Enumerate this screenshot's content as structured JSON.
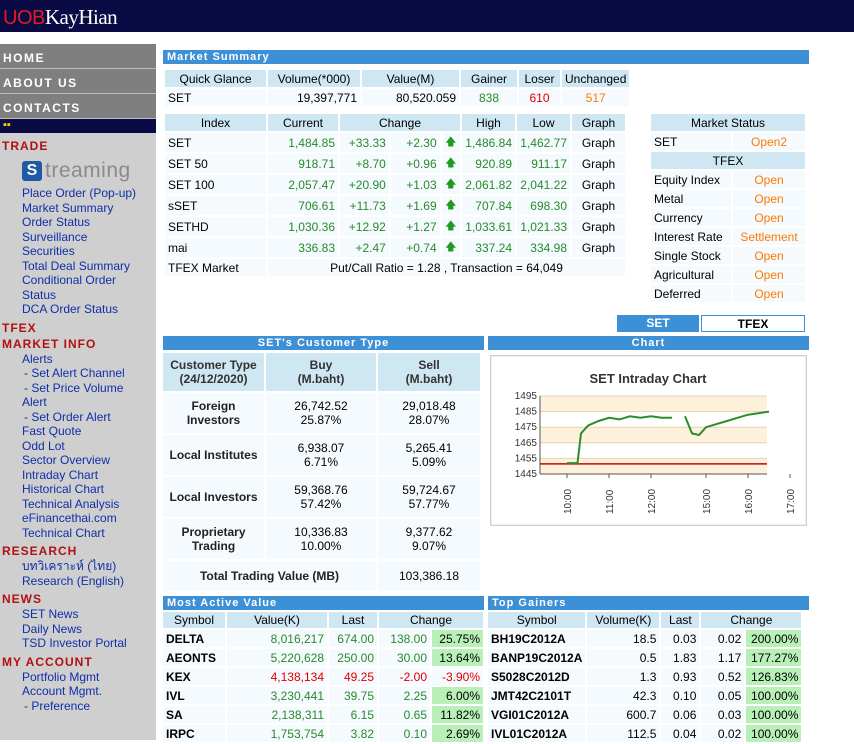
{
  "brand": {
    "part1": "UOB",
    "part2": "KayHian"
  },
  "nav": {
    "home": "HOME",
    "about": "ABOUT US",
    "contacts": "CONTACTS",
    "dots": "▪▪"
  },
  "side": {
    "trade": "TRADE",
    "streaming": "treaming",
    "streaming_s": "S",
    "trade_links": [
      "Place Order (Pop-up)",
      "Market Summary",
      "Order Status",
      "Surveillance",
      "Securities",
      "Total Deal Summary",
      "Conditional Order",
      "Status",
      "DCA Order Status"
    ],
    "tfex": "TFEX",
    "market_info": "MARKET INFO",
    "mi_links": [
      "Alerts",
      "- Set Alert Channel",
      "- Set Price Volume",
      "Alert",
      "- Set Order Alert",
      "Fast Quote",
      "Odd Lot",
      "Sector Overview",
      "Intraday Chart",
      "Historical Chart",
      "Technical Analysis",
      "eFinancethai.com",
      "Technical Chart"
    ],
    "research": "RESEARCH",
    "research_links": [
      "บทวิเคราะห์ (ไทย)",
      "Research (English)"
    ],
    "news": "NEWS",
    "news_links": [
      "SET News",
      "Daily News",
      "TSD Investor Portal"
    ],
    "myacc": "MY ACCOUNT",
    "acc_links": [
      "Portfolio Mgmt",
      "Account Mgmt.",
      "- Preference"
    ]
  },
  "summary": {
    "title": "Market Summary",
    "quick": {
      "headers": [
        "Quick Glance",
        "Volume(*000)",
        "Value(M)",
        "Gainer",
        "Loser",
        "Unchanged"
      ],
      "row": [
        "SET",
        "19,397,771",
        "80,520.059",
        "838",
        "610",
        "517"
      ]
    },
    "index": {
      "headers": [
        "Index",
        "Current",
        "Change",
        "High",
        "Low",
        "Graph"
      ],
      "rows": [
        [
          "SET",
          "1,484.85",
          "+33.33",
          "+2.30",
          "1,486.84",
          "1,462.77",
          "Graph"
        ],
        [
          "SET 50",
          "918.71",
          "+8.70",
          "+0.96",
          "920.89",
          "911.17",
          "Graph"
        ],
        [
          "SET 100",
          "2,057.47",
          "+20.90",
          "+1.03",
          "2,061.82",
          "2,041.22",
          "Graph"
        ],
        [
          "sSET",
          "706.61",
          "+11.73",
          "+1.69",
          "707.84",
          "698.30",
          "Graph"
        ],
        [
          "SETHD",
          "1,030.36",
          "+12.92",
          "+1.27",
          "1,033.61",
          "1,021.33",
          "Graph"
        ],
        [
          "mai",
          "336.83",
          "+2.47",
          "+0.74",
          "337.24",
          "334.98",
          "Graph"
        ]
      ],
      "tfex_label": "TFEX Market",
      "tfex_info": "Put/Call Ratio = 1.28 , Transaction = 64,049"
    },
    "status": {
      "header": "Market Status",
      "set_label": "SET",
      "set_val": "Open2",
      "tfex": "TFEX",
      "rows": [
        [
          "Equity Index",
          "Open"
        ],
        [
          "Metal",
          "Open"
        ],
        [
          "Currency",
          "Open"
        ],
        [
          "Interest Rate",
          "Settlement"
        ],
        [
          "Single Stock",
          "Open"
        ],
        [
          "Agricultural",
          "Open"
        ],
        [
          "Deferred",
          "Open"
        ]
      ]
    }
  },
  "tabs": {
    "set": "SET",
    "tfex": "TFEX"
  },
  "cust": {
    "title": "SET's Customer Type",
    "headers": [
      "Customer Type\n(24/12/2020)",
      "Buy\n(M.baht)",
      "Sell\n(M.baht)"
    ],
    "rows": [
      [
        "Foreign Investors",
        "26,742.52",
        "25.87%",
        "29,018.48",
        "28.07%"
      ],
      [
        "Local Institutes",
        "6,938.07",
        "6.71%",
        "5,265.41",
        "5.09%"
      ],
      [
        "Local Investors",
        "59,368.76",
        "57.42%",
        "59,724.67",
        "57.77%"
      ],
      [
        "Proprietary\nTrading",
        "10,336.83",
        "10.00%",
        "9,377.62",
        "9.07%"
      ]
    ],
    "total_label": "Total Trading Value (MB)",
    "total": "103,386.18"
  },
  "chart": {
    "bar": "Chart"
  },
  "chart_data": {
    "type": "line",
    "title": "SET Intraday Chart",
    "ylim": [
      1445,
      1495
    ],
    "yticks": [
      1495,
      1485,
      1475,
      1465,
      1455,
      1445
    ],
    "xticks": [
      "10:00",
      "11:00",
      "12:00",
      "15:00",
      "16:00",
      "17:00"
    ],
    "reference": 1451.52,
    "series": [
      {
        "x": [
          "10:00",
          "10:15",
          "10:20",
          "10:30",
          "10:45",
          "11:00",
          "11:15",
          "11:30",
          "11:45",
          "12:00",
          "12:15",
          "12:30",
          "14:30",
          "14:40",
          "14:50",
          "15:00",
          "15:15",
          "15:30",
          "15:45",
          "16:00",
          "16:15",
          "16:30"
        ],
        "y": [
          1452,
          1452,
          1471,
          1476,
          1479,
          1481,
          1480,
          1482,
          1481,
          1482,
          1481,
          1481,
          1482,
          1471,
          1470,
          1475,
          1477,
          1479,
          1481,
          1483,
          1484,
          1485
        ]
      }
    ]
  },
  "active": {
    "title": "Most Active Value",
    "headers": [
      "Symbol",
      "Value(K)",
      "Last",
      "Change"
    ],
    "rows": [
      [
        "DELTA",
        "8,016,217",
        "674.00",
        "138.00",
        "25.75%",
        "g"
      ],
      [
        "AEONTS",
        "5,220,628",
        "250.00",
        "30.00",
        "13.64%",
        "g"
      ],
      [
        "KEX",
        "4,138,134",
        "49.25",
        "-2.00",
        "-3.90%",
        "r"
      ],
      [
        "IVL",
        "3,230,441",
        "39.75",
        "2.25",
        "6.00%",
        "g"
      ],
      [
        "SA",
        "2,138,311",
        "6.15",
        "0.65",
        "11.82%",
        "g"
      ],
      [
        "IRPC",
        "1,753,754",
        "3.82",
        "0.10",
        "2.69%",
        "g"
      ]
    ]
  },
  "gainers": {
    "title": "Top Gainers",
    "headers": [
      "Symbol",
      "Volume(K)",
      "Last",
      "Change"
    ],
    "rows": [
      [
        "BH19C2012A",
        "18.5",
        "0.03",
        "0.02",
        "200.00%"
      ],
      [
        "BANP19C2012A",
        "0.5",
        "1.83",
        "1.17",
        "177.27%"
      ],
      [
        "S5028C2012D",
        "1.3",
        "0.93",
        "0.52",
        "126.83%"
      ],
      [
        "JMT42C2101T",
        "42.3",
        "0.10",
        "0.05",
        "100.00%"
      ],
      [
        "VGI01C2012A",
        "600.7",
        "0.06",
        "0.03",
        "100.00%"
      ],
      [
        "IVL01C2012A",
        "112.5",
        "0.04",
        "0.02",
        "100.00%"
      ]
    ]
  }
}
